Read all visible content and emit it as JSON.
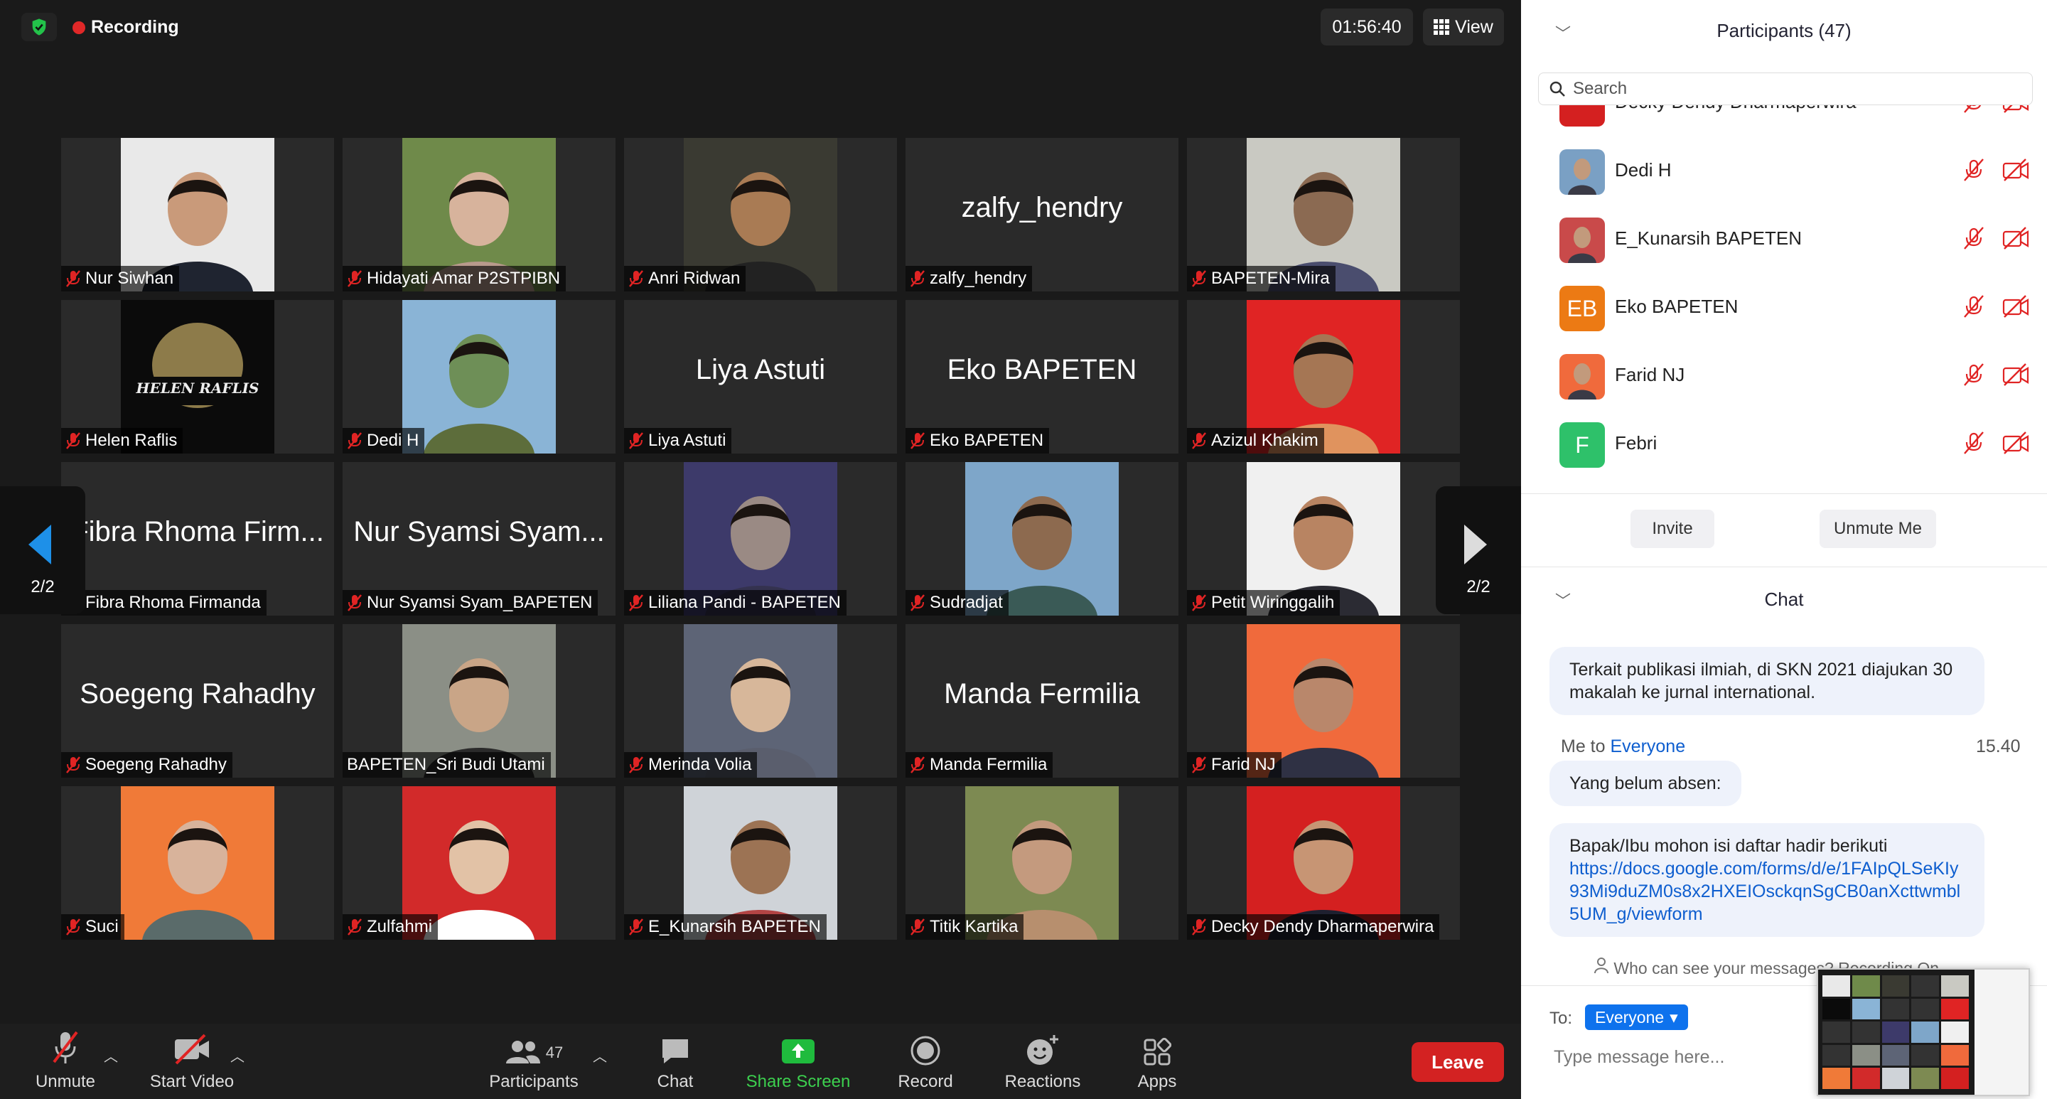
{
  "topbar": {
    "recording": "Recording",
    "timer": "01:56:40",
    "view": "View"
  },
  "gallery": [
    {
      "name": "Nur Siwhan",
      "photo": true,
      "bg": "#e9e9e9",
      "face": "#c99a7a",
      "cloth": "#1f2430"
    },
    {
      "name": "Hidayati Amar P2STPIBN",
      "photo": true,
      "bg": "#6f8a4a",
      "face": "#d7b39c",
      "cloth": "#b89a8c"
    },
    {
      "name": "Anri Ridwan",
      "photo": true,
      "bg": "#3a3a32",
      "face": "#a97b54",
      "cloth": "#222"
    },
    {
      "name": "zalfy_hendry",
      "big": "zalfy_hendry"
    },
    {
      "name": "BAPETEN-Mira",
      "photo": true,
      "bg": "#c9c9c2",
      "face": "#8b6a52",
      "cloth": "#4a4d6e"
    },
    {
      "name": "Helen Raflis",
      "photo": true,
      "bg": "#0b0b0b",
      "logo": "HELEN RAFLIS"
    },
    {
      "name": "Dedi H",
      "photo": true,
      "bg": "#8ab4d6",
      "face": "#6e8f57",
      "cloth": "#5d6d3b"
    },
    {
      "name": "Liya Astuti",
      "big": "Liya Astuti"
    },
    {
      "name": "Eko BAPETEN",
      "big": "Eko BAPETEN"
    },
    {
      "name": "Azizul Khakim",
      "photo": true,
      "bg": "#e02424",
      "face": "#a57654",
      "cloth": "#e0935e"
    },
    {
      "name": "Fibra Rhoma Firmanda",
      "big": "Fibra Rhoma Firm..."
    },
    {
      "name": "Nur Syamsi Syam_BAPETEN",
      "big": "Nur Syamsi Syam..."
    },
    {
      "name": "Liliana Pandi - BAPETEN",
      "photo": true,
      "bg": "#3d3a6a",
      "face": "#9a8a84",
      "cloth": "#34324f"
    },
    {
      "name": "Sudradjat",
      "photo": true,
      "bg": "#7ea6c9",
      "face": "#8d6a4f",
      "cloth": "#3a5a56"
    },
    {
      "name": "Petit Wiringgalih",
      "photo": true,
      "bg": "#f0f0f0",
      "face": "#b88462",
      "cloth": "#2b2b33"
    },
    {
      "name": "Soegeng Rahadhy",
      "big": "Soegeng Rahadhy"
    },
    {
      "name": "BAPETEN_Sri Budi Utami",
      "photo": true,
      "bg": "#8b8f86",
      "face": "#c9a587",
      "cloth": "#2a2a2a",
      "nomic": true
    },
    {
      "name": "Merinda Volia",
      "photo": true,
      "bg": "#5d6476",
      "face": "#d7b79a",
      "cloth": "#5a5e6d"
    },
    {
      "name": "Manda Fermilia",
      "big": "Manda Fermilia"
    },
    {
      "name": "Farid NJ",
      "photo": true,
      "bg": "#f06a3c",
      "face": "#b9876b",
      "cloth": "#2f3144"
    },
    {
      "name": "Suci",
      "photo": true,
      "bg": "#f07a38",
      "face": "#d8b39b",
      "cloth": "#5a6b6a"
    },
    {
      "name": "Zulfahmi",
      "photo": true,
      "bg": "#d22a2a",
      "face": "#e2c2a6",
      "cloth": "#ffffff"
    },
    {
      "name": "E_Kunarsih BAPETEN",
      "photo": true,
      "bg": "#cfd3d8",
      "face": "#9c7354",
      "cloth": "#b34444"
    },
    {
      "name": "Titik Kartika",
      "photo": true,
      "bg": "#7d8a52",
      "face": "#c49a7e",
      "cloth": "#b78f6e"
    },
    {
      "name": "Decky Dendy Dharmaperwira",
      "photo": true,
      "bg": "#d42020",
      "face": "#c79574",
      "cloth": "#1e2030"
    }
  ],
  "pager": {
    "label": "2/2"
  },
  "toolbar": {
    "unmute": "Unmute",
    "start_video": "Start Video",
    "participants": "Participants",
    "participants_count": "47",
    "chat": "Chat",
    "share": "Share Screen",
    "record": "Record",
    "reactions": "Reactions",
    "apps": "Apps",
    "leave": "Leave"
  },
  "participants_panel": {
    "title": "Participants (47)",
    "search_placeholder": "Search",
    "partial": "Decky Dendy Dharmaperwira",
    "rows": [
      {
        "name": "Dedi H",
        "avatar": "photo",
        "color": "#7aa0c4"
      },
      {
        "name": "E_Kunarsih BAPETEN",
        "avatar": "photo",
        "color": "#c94a4a"
      },
      {
        "name": "Eko BAPETEN",
        "avatar": "EB",
        "color": "#ec7a14"
      },
      {
        "name": "Farid NJ",
        "avatar": "photo",
        "color": "#f06a3c"
      },
      {
        "name": "Febri",
        "avatar": "F",
        "color": "#2ec16a"
      }
    ],
    "invite": "Invite",
    "unmute_me": "Unmute Me"
  },
  "chat": {
    "title": "Chat",
    "msg1": "Terkait publikasi ilmiah, di SKN 2021 diajukan 30 makalah ke jurnal international.",
    "meta_from": "Me to ",
    "meta_to": "Everyone",
    "meta_time": "15.40",
    "msg2": "Yang belum absen:",
    "msg3": "Bapak/Ibu mohon isi daftar hadir berikuti",
    "link": "https://docs.google.com/forms/d/e/1FAIpQLSeKIy93Mi9duZM0s8x2HXEIOsckqnSgCB0anXcttwmbl5UM_g/viewform",
    "who_can_see": "Who can see your messages? Recording On",
    "to_label": "To:",
    "to_value": "Everyone",
    "placeholder": "Type message here..."
  }
}
